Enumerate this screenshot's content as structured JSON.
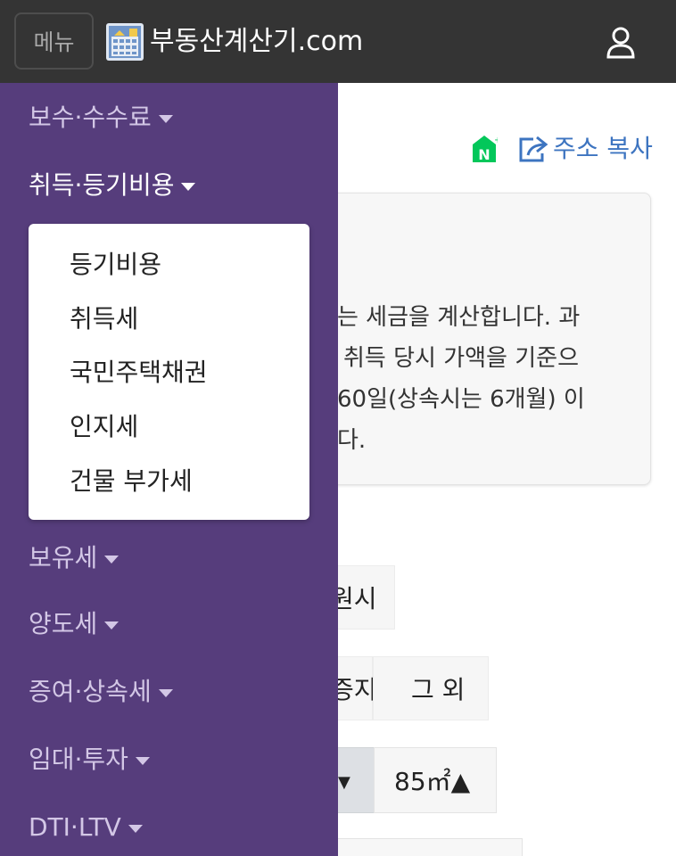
{
  "header": {
    "menu_label": "메뉴",
    "site_title": "부동산계산기.com"
  },
  "page": {
    "copy_address": "주소 복사",
    "info_lines": [
      "는 세금을 계산합니다. 과",
      "취득 당시 가액을 기준으",
      "60일(상속시는 6개월) 이",
      "다."
    ],
    "option_row1": "원시",
    "option_row2_a": "증지",
    "option_row2_b": "그 외",
    "area_value": "85㎡▲",
    "area_select_arrow": "▼"
  },
  "sidebar": {
    "items": [
      {
        "label": "보수·수수료"
      },
      {
        "label": "취득·등기비용"
      },
      {
        "label": "보유세"
      },
      {
        "label": "양도세"
      },
      {
        "label": "증여·상속세"
      },
      {
        "label": "임대·투자"
      },
      {
        "label": "DTI·LTV"
      }
    ],
    "dropdown": [
      "등기비용",
      "취득세",
      "국민주택채권",
      "인지세",
      "건물 부가세"
    ]
  },
  "colors": {
    "header_bg": "#343434",
    "sidebar_bg": "#563d7c",
    "link_blue": "#3d74c0",
    "naver_green": "#03c75a"
  }
}
